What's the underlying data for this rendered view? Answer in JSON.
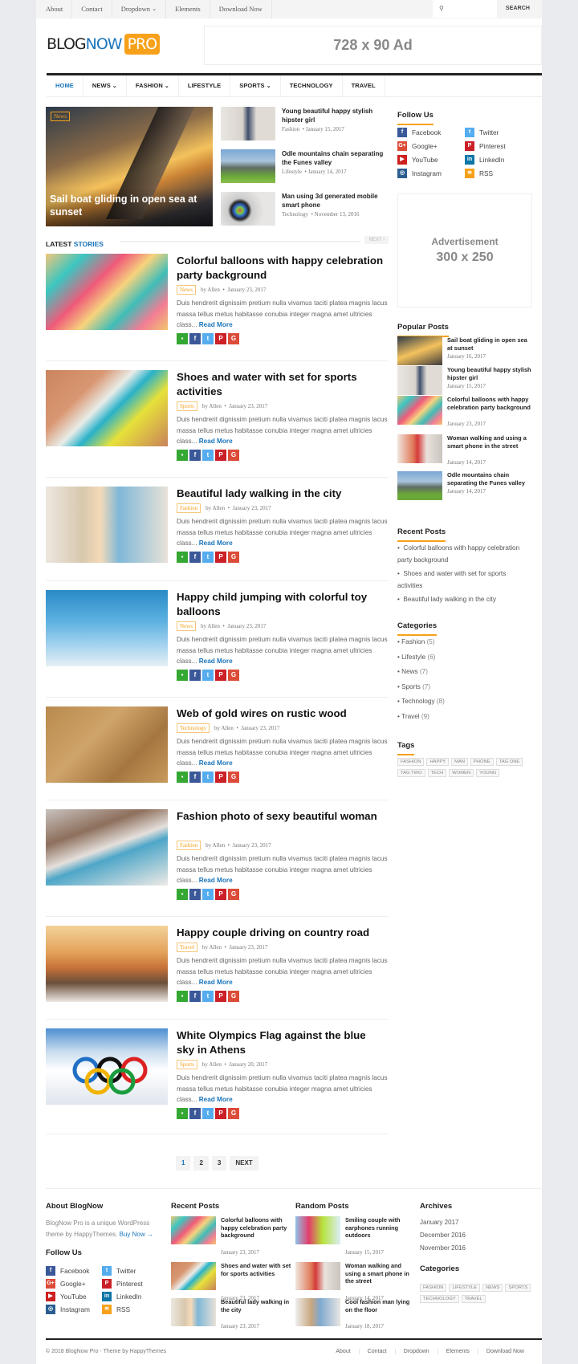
{
  "topbar": {
    "links": [
      "About",
      "Contact",
      "Dropdown",
      "Elements",
      "Download Now"
    ],
    "search_placeholder": "",
    "search_button": "SEARCH"
  },
  "header": {
    "logo": {
      "part1": "BLOG",
      "part2": "NOW",
      "part3": "PRO"
    },
    "ad_text": "728 x 90 Ad"
  },
  "mainnav": {
    "items": [
      {
        "label": "HOME",
        "active": true,
        "dropdown": false
      },
      {
        "label": "NEWS",
        "dropdown": true
      },
      {
        "label": "FASHION",
        "dropdown": true
      },
      {
        "label": "LIFESTYLE",
        "dropdown": false
      },
      {
        "label": "SPORTS",
        "dropdown": true
      },
      {
        "label": "TECHNOLOGY",
        "dropdown": false
      },
      {
        "label": "TRAVEL",
        "dropdown": false
      }
    ]
  },
  "featured": {
    "big": {
      "category": "News",
      "title": "Sail boat gliding in open sea at sunset"
    },
    "list": [
      {
        "title": "Young beautiful happy stylish hipster girl",
        "category": "Fashion",
        "date": "January 15, 2017"
      },
      {
        "title": "Odle mountains chain separating the Funes valley",
        "category": "Lifestyle",
        "date": "January 14, 2017"
      },
      {
        "title": "Man using 3d generated mobile smart phone",
        "category": "Technology",
        "date": "November 13, 2016"
      }
    ]
  },
  "latest": {
    "label_a": "LATEST ",
    "label_b": "STORIES",
    "next_label": "NEXT ›",
    "read_more": "Read More",
    "byline": "by Allen",
    "excerpt": "Duis hendrerit dignissim pretium nulla vivamus taciti platea magnis lacus massa tellus metus habitasse conubia integer magna amet ultricies class... ",
    "posts": [
      {
        "title": "Colorful balloons with happy celebration party background",
        "category": "News",
        "date": "January 23, 2017"
      },
      {
        "title": "Shoes and water with set for sports activities",
        "category": "Sports",
        "date": "January 23, 2017"
      },
      {
        "title": "Beautiful lady walking in the city",
        "category": "Fashion",
        "date": "January 23, 2017"
      },
      {
        "title": "Happy child jumping with colorful toy balloons",
        "category": "News",
        "date": "January 23, 2017"
      },
      {
        "title": "Web of gold wires on rustic wood",
        "category": "Technology",
        "date": "January 23, 2017"
      },
      {
        "title": "Fashion photo of sexy beautiful woman",
        "category": "Fashion",
        "date": "January 23, 2017"
      },
      {
        "title": "Happy couple driving on country road",
        "category": "Travel",
        "date": "January 23, 2017"
      },
      {
        "title": "White Olympics Flag against the blue sky in Athens",
        "category": "Sports",
        "date": "January 20, 2017"
      }
    ]
  },
  "pagination": {
    "pages": [
      "1",
      "2",
      "3"
    ],
    "current": "1",
    "next": "NEXT"
  },
  "sidebar": {
    "follow_title": "Follow Us",
    "social": [
      {
        "label": "Facebook",
        "icon": "facebook-icon",
        "glyph": "f",
        "color": "#3b5998"
      },
      {
        "label": "Twitter",
        "icon": "twitter-icon",
        "glyph": "t",
        "color": "#55acee"
      },
      {
        "label": "Google+",
        "icon": "google-plus-icon",
        "glyph": "G+",
        "color": "#dd4b39"
      },
      {
        "label": "Pinterest",
        "icon": "pinterest-icon",
        "glyph": "P",
        "color": "#cb2027"
      },
      {
        "label": "YouTube",
        "icon": "youtube-icon",
        "glyph": "▶",
        "color": "#cd201f"
      },
      {
        "label": "LinkedIn",
        "icon": "linkedin-icon",
        "glyph": "in",
        "color": "#0e76a8"
      },
      {
        "label": "Instagram",
        "icon": "instagram-icon",
        "glyph": "◎",
        "color": "#2a5d8f"
      },
      {
        "label": "RSS",
        "icon": "rss-icon",
        "glyph": "≋",
        "color": "#f7a11a"
      }
    ],
    "ad_line1": "Advertisement",
    "ad_line2": "300 x 250",
    "popular_title": "Popular Posts",
    "popular": [
      {
        "title": "Sail boat gliding in open sea at sunset",
        "date": "January 16, 2017"
      },
      {
        "title": "Young beautiful happy stylish hipster girl",
        "date": "January 15, 2017"
      },
      {
        "title": "Colorful balloons with happy celebration party background",
        "date": "January 23, 2017"
      },
      {
        "title": "Woman walking and using a smart phone in the street",
        "date": "January 14, 2017"
      },
      {
        "title": "Odle mountains chain separating the Funes valley",
        "date": "January 14, 2017"
      }
    ],
    "recent_title": "Recent Posts",
    "recent": [
      "Colorful balloons with happy celebration party background",
      "Shoes and water with set for sports activities",
      "Beautiful lady walking in the city"
    ],
    "categories_title": "Categories",
    "categories": [
      {
        "name": "Fashion",
        "count": "(5)"
      },
      {
        "name": "Lifestyle",
        "count": "(6)"
      },
      {
        "name": "News",
        "count": "(7)"
      },
      {
        "name": "Sports",
        "count": "(7)"
      },
      {
        "name": "Technology",
        "count": "(8)"
      },
      {
        "name": "Travel",
        "count": "(9)"
      }
    ],
    "tags_title": "Tags",
    "tags": [
      "FASHION",
      "HAPPY",
      "MAN",
      "PHONE",
      "TAG ONE",
      "TAG TWO",
      "TECH",
      "WOMEN",
      "YOUNG"
    ]
  },
  "footer": {
    "about_title": "About BlogNow",
    "about_text": "BlogNow Pro is a unique WordPress theme by HappyThemes. ",
    "buy_now": "Buy Now →",
    "follow_title": "Follow Us",
    "recent_title": "Recent Posts",
    "recent": [
      {
        "title": "Colorful balloons with happy celebration party background",
        "date": "January 23, 2017"
      },
      {
        "title": "Shoes and water with set for sports activities",
        "date": "January 23, 2017"
      },
      {
        "title": "Beautiful lady walking in the city",
        "date": "January 23, 2017"
      }
    ],
    "random_title": "Random Posts",
    "random": [
      {
        "title": "Smiling couple with earphones running outdoors",
        "date": "January 15, 2017"
      },
      {
        "title": "Woman walking and using a smart phone in the street",
        "date": "January 14, 2017"
      },
      {
        "title": "Cool fashion man lying on the floor",
        "date": "January 18, 2017"
      }
    ],
    "archives_title": "Archives",
    "archives": [
      "January 2017",
      "December 2016",
      "November 2016"
    ],
    "categories_title": "Categories",
    "categories": [
      "FASHION",
      "LIFESTYLE",
      "NEWS",
      "SPORTS",
      "TECHNOLOGY",
      "TRAVEL"
    ],
    "copyright": "© 2018 BlogNow Pro - Theme by HappyThemes",
    "links": [
      "About",
      "Contact",
      "Dropdown",
      "Elements",
      "Download Now"
    ]
  },
  "colors": {
    "accent": "#f7a11a",
    "brand_blue": "#1b75bb",
    "dark": "#222222"
  }
}
